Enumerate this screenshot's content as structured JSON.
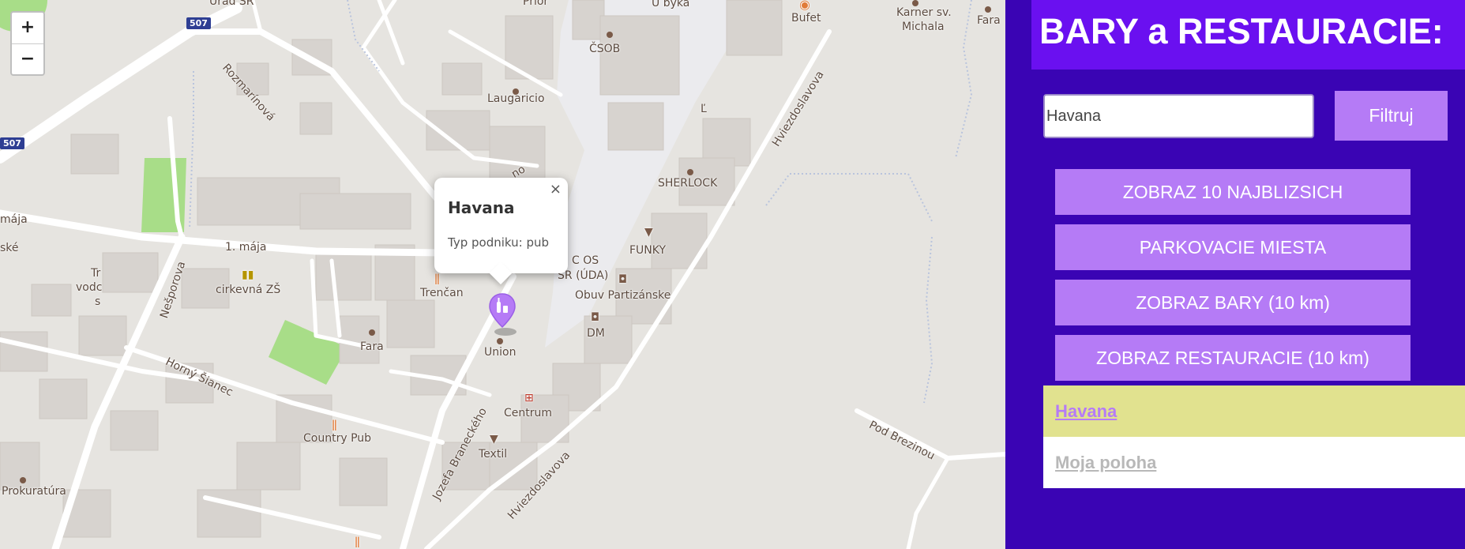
{
  "map": {
    "zoom_in": "+",
    "zoom_out": "−",
    "road_shields": [
      "507",
      "507"
    ],
    "street_labels": [
      "Rozmarínová",
      "1. mája",
      "mája",
      "Nešporova",
      "Horný Šianec",
      "Jozefa Braneckého",
      "Hviezdoslavova",
      "Hviezdoslavova",
      "Pod Brezinou"
    ],
    "place_labels": [
      "Úrad SR",
      "Prior",
      "U býka",
      "Bufet",
      "Karner sv.",
      "Michala",
      "Fara",
      "ČSOB",
      "Laugaricio",
      "Ľ",
      "SHERLOCK",
      "FUNKY",
      "C OS",
      "SR (ÚDA)",
      "Obuv Partizánske",
      "DM",
      "Trenčan",
      "Union",
      "cirkevná ZŠ",
      "Fara",
      "Centrum",
      "Country Pub",
      "Textil",
      "Prokuratúra",
      "ské",
      "Tr",
      "vodc",
      "s",
      "no"
    ],
    "popup": {
      "title": "Havana",
      "type_text": "Typ podniku: pub",
      "close_icon": "×"
    },
    "marker_icon": "bar-bottle-icon"
  },
  "panel": {
    "title": "BARY a RESTAURACIE:",
    "search": {
      "value": "Havana",
      "placeholder": ""
    },
    "filter_label": "Filtruj",
    "buttons": [
      "ZOBRAZ 10 NAJBLIZSICH",
      "PARKOVACIE MIESTA",
      "ZOBRAZ BARY (10 km)",
      "ZOBRAZ RESTAURACIE (10 km)"
    ],
    "results": [
      {
        "label": "Havana",
        "bg": "#e1e28f",
        "color": "#b57bf6"
      },
      {
        "label": "Moja poloha",
        "bg": "#ffffff",
        "color": "#b8b8b8"
      }
    ]
  },
  "colors": {
    "panel_bg": "#3a04b4",
    "heading_bg": "#6a10f0",
    "button_bg": "#b57bf6",
    "park_green": "#a8dd88",
    "pedestrian_zone": "#ebebee"
  }
}
